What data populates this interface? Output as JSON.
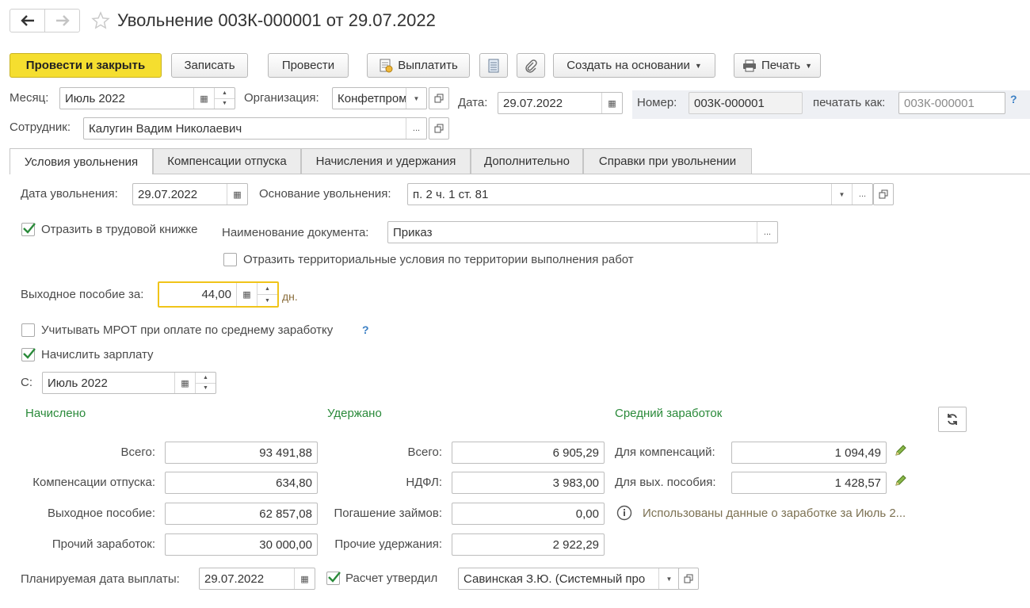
{
  "window": {
    "title": "Увольнение 003К-000001 от 29.07.2022"
  },
  "toolbar": {
    "post_close": "Провести и закрыть",
    "save": "Записать",
    "post": "Провести",
    "pay": "Выплатить",
    "create_based": "Создать на основании",
    "print": "Печать"
  },
  "header": {
    "month_label": "Месяц:",
    "month_value": "Июль 2022",
    "org_label": "Организация:",
    "org_value": "Конфетпром",
    "date_label": "Дата:",
    "date_value": "29.07.2022",
    "number_label": "Номер:",
    "number_value": "003К-000001",
    "print_as_label": "печатать как:",
    "print_as_placeholder": "003К-000001",
    "employee_label": "Сотрудник:",
    "employee_value": "Калугин Вадим Николаевич"
  },
  "tabs": [
    {
      "label": "Условия увольнения"
    },
    {
      "label": "Компенсации отпуска"
    },
    {
      "label": "Начисления и удержания"
    },
    {
      "label": "Дополнительно"
    },
    {
      "label": "Справки при увольнении"
    }
  ],
  "form": {
    "dismissal_date_label": "Дата увольнения:",
    "dismissal_date_value": "29.07.2022",
    "basis_label": "Основание увольнения:",
    "basis_value": "п. 2 ч. 1 ст. 81",
    "workbook_label": "Отразить в трудовой книжке",
    "doc_name_label": "Наименование документа:",
    "doc_name_value": "Приказ",
    "territorial_label": "Отразить территориальные условия по территории выполнения работ",
    "severance_label": "Выходное пособие за:",
    "severance_value": "44,00",
    "severance_unit": "дн.",
    "mrot_label": "Учитывать МРОТ при оплате по среднему заработку",
    "accrue_label": "Начислить зарплату",
    "from_label": "С:",
    "from_value": "Июль 2022"
  },
  "accrued": {
    "title": "Начислено",
    "rows": [
      {
        "label": "Всего:",
        "value": "93 491,88"
      },
      {
        "label": "Компенсации отпуска:",
        "value": "634,80"
      },
      {
        "label": "Выходное пособие:",
        "value": "62 857,08"
      },
      {
        "label": "Прочий заработок:",
        "value": "30 000,00"
      }
    ]
  },
  "withheld": {
    "title": "Удержано",
    "rows": [
      {
        "label": "Всего:",
        "value": "6 905,29"
      },
      {
        "label": "НДФЛ:",
        "value": "3 983,00"
      },
      {
        "label": "Погашение займов:",
        "value": "0,00"
      },
      {
        "label": "Прочие удержания:",
        "value": "2 922,29"
      }
    ]
  },
  "average": {
    "title": "Средний заработок",
    "rows": [
      {
        "label": "Для компенсаций:",
        "value": "1 094,49"
      },
      {
        "label": "Для вых. пособия:",
        "value": "1 428,57"
      }
    ],
    "info_link": "Использованы данные о заработке за Июль 2..."
  },
  "footer": {
    "pay_date_label": "Планируемая дата выплаты:",
    "pay_date_value": "29.07.2022",
    "approved_label": "Расчет утвердил",
    "approved_value": "Савинская З.Ю. (Системный про"
  },
  "colors": {
    "primary_button": "#f5de2f",
    "section_title": "#2a8a3a",
    "focus_border": "#f0c419",
    "help": "#3a7fc4"
  }
}
